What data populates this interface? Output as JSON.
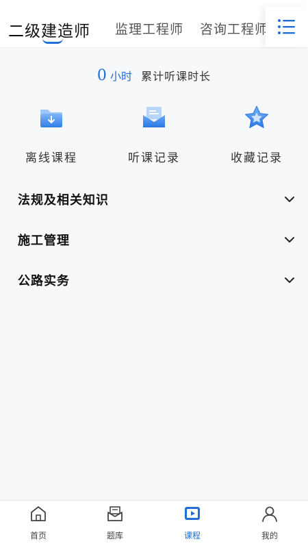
{
  "header": {
    "tabs": [
      {
        "label": "二级建造师",
        "active": true
      },
      {
        "label": "监理工程师",
        "active": false
      },
      {
        "label": "咨询工程师",
        "active": false
      }
    ],
    "menu_icon": "list-menu-icon"
  },
  "stats": {
    "hours": "0",
    "unit": "小时",
    "label": "累计听课时长"
  },
  "actions": [
    {
      "label": "离线课程",
      "icon": "folder-download-icon"
    },
    {
      "label": "听课记录",
      "icon": "mail-record-icon"
    },
    {
      "label": "收藏记录",
      "icon": "star-icon"
    }
  ],
  "subjects": [
    {
      "name": "法规及相关知识"
    },
    {
      "name": "施工管理"
    },
    {
      "name": "公路实务"
    }
  ],
  "bottom_nav": [
    {
      "label": "首页",
      "icon": "home-icon",
      "active": false
    },
    {
      "label": "题库",
      "icon": "mailbox-icon",
      "active": false
    },
    {
      "label": "课程",
      "icon": "play-course-icon",
      "active": true
    },
    {
      "label": "我的",
      "icon": "user-icon",
      "active": false
    }
  ],
  "colors": {
    "accent": "#1f6fd6",
    "background": "#f7f8fa"
  }
}
